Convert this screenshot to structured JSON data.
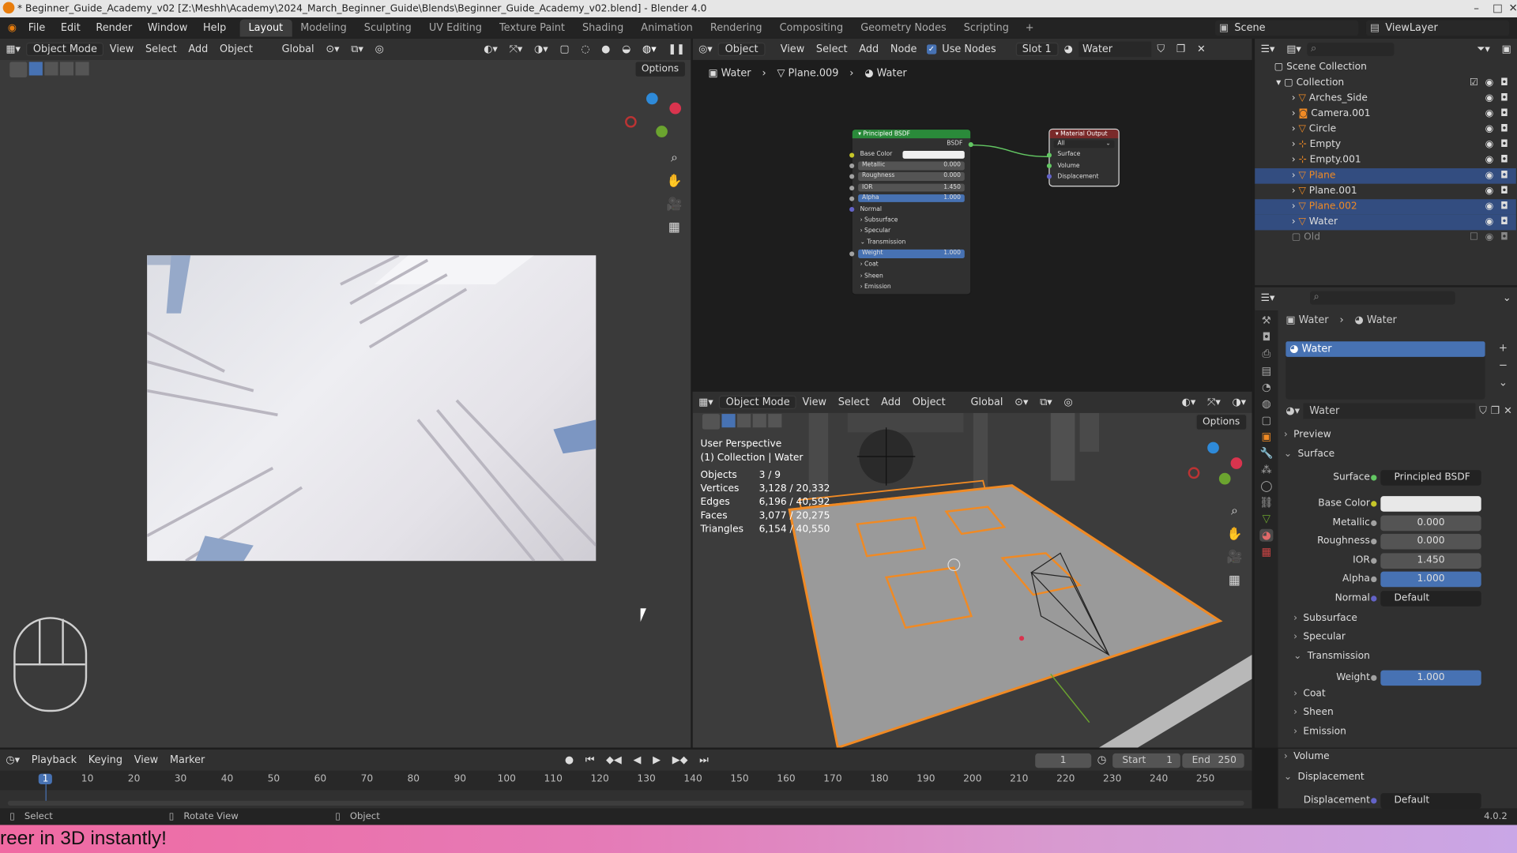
{
  "window": {
    "title": "* Beginner_Guide_Academy_v02 [Z:\\Meshh\\Academy\\2024_March_Beginner_Guide\\Blends\\Beginner_Guide_Academy_v02.blend] - Blender 4.0"
  },
  "menu": [
    "File",
    "Edit",
    "Render",
    "Window",
    "Help"
  ],
  "workspaces": [
    "Layout",
    "Modeling",
    "Sculpting",
    "UV Editing",
    "Texture Paint",
    "Shading",
    "Animation",
    "Rendering",
    "Compositing",
    "Geometry Nodes",
    "Scripting"
  ],
  "active_workspace": "Layout",
  "scene": {
    "label": "Scene",
    "view_layer": "ViewLayer"
  },
  "viewport_left": {
    "mode": "Object Mode",
    "menus": [
      "View",
      "Select",
      "Add",
      "Object"
    ],
    "orientation": "Global",
    "options": "Options"
  },
  "node_editor": {
    "type_label": "Object",
    "menus": [
      "View",
      "Select",
      "Add",
      "Node"
    ],
    "use_nodes": "Use Nodes",
    "slot": "Slot 1",
    "material": "Water",
    "breadcrumb": [
      "Water",
      "Plane.009",
      "Water"
    ],
    "bsdf_node": {
      "title": "Principled BSDF",
      "output": "BSDF",
      "rows": [
        {
          "label": "Base Color",
          "value": ""
        },
        {
          "label": "Metallic",
          "value": "0.000"
        },
        {
          "label": "Roughness",
          "value": "0.000"
        },
        {
          "label": "IOR",
          "value": "1.450"
        },
        {
          "label": "Alpha",
          "value": "1.000"
        }
      ],
      "normal": "Normal",
      "subpanels_a": [
        "Subsurface",
        "Specular",
        "Transmission"
      ],
      "weight": {
        "label": "Weight",
        "value": "1.000"
      },
      "subpanels_b": [
        "Coat",
        "Sheen",
        "Emission"
      ]
    },
    "output_node": {
      "title": "Material Output",
      "target": "All",
      "inputs": [
        "Surface",
        "Volume",
        "Displacement"
      ]
    }
  },
  "viewport_right": {
    "mode": "Object Mode",
    "menus": [
      "View",
      "Select",
      "Add",
      "Object"
    ],
    "orientation": "Global",
    "options": "Options",
    "perspective": "User Perspective",
    "collection": "(1) Collection | Water",
    "stats": [
      {
        "label": "Objects",
        "value": "3 / 9"
      },
      {
        "label": "Vertices",
        "value": "3,128 / 20,332"
      },
      {
        "label": "Edges",
        "value": "6,196 / 40,592"
      },
      {
        "label": "Faces",
        "value": "3,077 / 20,275"
      },
      {
        "label": "Triangles",
        "value": "6,154 / 40,550"
      }
    ]
  },
  "outliner": {
    "root": "Scene Collection",
    "collection": "Collection",
    "items": [
      {
        "name": "Arches_Side",
        "selected": false,
        "highlight": false
      },
      {
        "name": "Camera.001",
        "selected": false,
        "highlight": false
      },
      {
        "name": "Circle",
        "selected": false,
        "highlight": false
      },
      {
        "name": "Empty",
        "selected": false,
        "highlight": false
      },
      {
        "name": "Empty.001",
        "selected": false,
        "highlight": false
      },
      {
        "name": "Plane",
        "selected": true,
        "highlight": true
      },
      {
        "name": "Plane.001",
        "selected": false,
        "highlight": false
      },
      {
        "name": "Plane.002",
        "selected": true,
        "highlight": true
      },
      {
        "name": "Water",
        "selected": true,
        "highlight": false
      }
    ],
    "old": "Old"
  },
  "properties": {
    "breadcrumb": [
      "Water",
      "Water"
    ],
    "slot_name": "Water",
    "material_name": "Water",
    "preview": "Preview",
    "surface_section": "Surface",
    "surface_label": "Surface",
    "surface_value": "Principled BSDF",
    "rows": [
      {
        "label": "Base Color",
        "value": "",
        "kind": "white"
      },
      {
        "label": "Metallic",
        "value": "0.000",
        "kind": "gray"
      },
      {
        "label": "Roughness",
        "value": "0.000",
        "kind": "gray"
      },
      {
        "label": "IOR",
        "value": "1.450",
        "kind": "gray"
      },
      {
        "label": "Alpha",
        "value": "1.000",
        "kind": "blue"
      },
      {
        "label": "Normal",
        "value": "Default",
        "kind": "dark"
      }
    ],
    "collapsed_a": [
      "Subsurface",
      "Specular"
    ],
    "transmission": "Transmission",
    "weight": {
      "label": "Weight",
      "value": "1.000"
    },
    "collapsed_b": [
      "Coat",
      "Sheen",
      "Emission"
    ],
    "volume": "Volume",
    "displacement_section": "Displacement",
    "displacement": {
      "label": "Displacement",
      "value": "Default"
    }
  },
  "timeline": {
    "menus": [
      "Playback",
      "Keying",
      "View",
      "Marker"
    ],
    "current_frame": "1",
    "start_label": "Start",
    "start": "1",
    "end_label": "End",
    "end": "250",
    "ticks": [
      "1",
      "10",
      "20",
      "30",
      "40",
      "50",
      "60",
      "70",
      "80",
      "90",
      "100",
      "110",
      "120",
      "130",
      "140",
      "150",
      "160",
      "170",
      "180",
      "190",
      "200",
      "210",
      "220",
      "230",
      "240",
      "250"
    ]
  },
  "statusbar": {
    "items": [
      "Select",
      "Rotate View",
      "Object"
    ],
    "version": "4.0.2"
  },
  "banner": {
    "text": "reer in 3D instantly!"
  },
  "colors": {
    "selection_orange": "#f08a24",
    "active_blue": "#4772b3",
    "node_green_header": "#2a8a3a",
    "node_red_header": "#7a2a2a"
  }
}
